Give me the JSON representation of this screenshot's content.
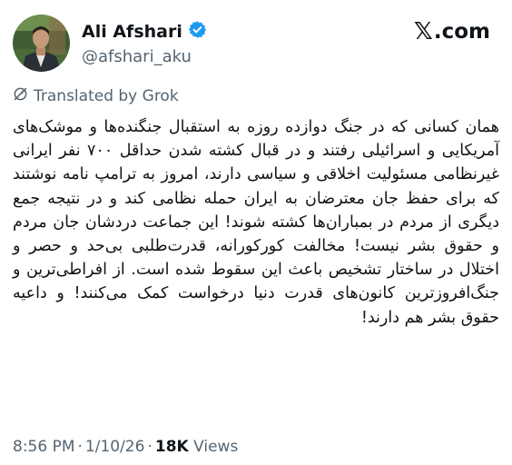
{
  "header": {
    "display_name": "Ali Afshari",
    "handle": "@afshari_aku",
    "verified_color": "#1d9bf0",
    "brand_x": "𝕏",
    "brand_text": ".com"
  },
  "translation": {
    "label": "Translated by Grok",
    "icon": "grok-icon"
  },
  "post": {
    "text": "همان کسانی که در جنگ دوازده روزه به استقبال جنگنده‌ها و موشک‌های آمریکایی و اسرائیلی رفتند و در قبال کشته شدن حداقل ۷۰۰ نفر ایرانی غیرنظامی مسئولیت اخلاقی و سیاسی دارند، امروز به ترامپ نامه نوشتند که برای حفظ جان معترضان به ایران حمله نظامی کند و در نتیجه جمع دیگری از مردم در بمباران‌ها کشته شوند! این جماعت دردشان جان مردم و حقوق بشر نیست! مخالفت کورکورانه، قدرت‌طلبی بی‌حد و حصر و اختلال در ساختار تشخیص باعث این سقوط شده است. از افراطی‌ترین و جنگ‌افروزترین کانون‌های قدرت دنیا درخواست کمک می‌کنند! و داعیه حقوق بشر هم دارند!"
  },
  "meta": {
    "time": "8:56 PM",
    "separator": "·",
    "date": "1/10/26",
    "views_count": "18K",
    "views_label": "Views"
  }
}
